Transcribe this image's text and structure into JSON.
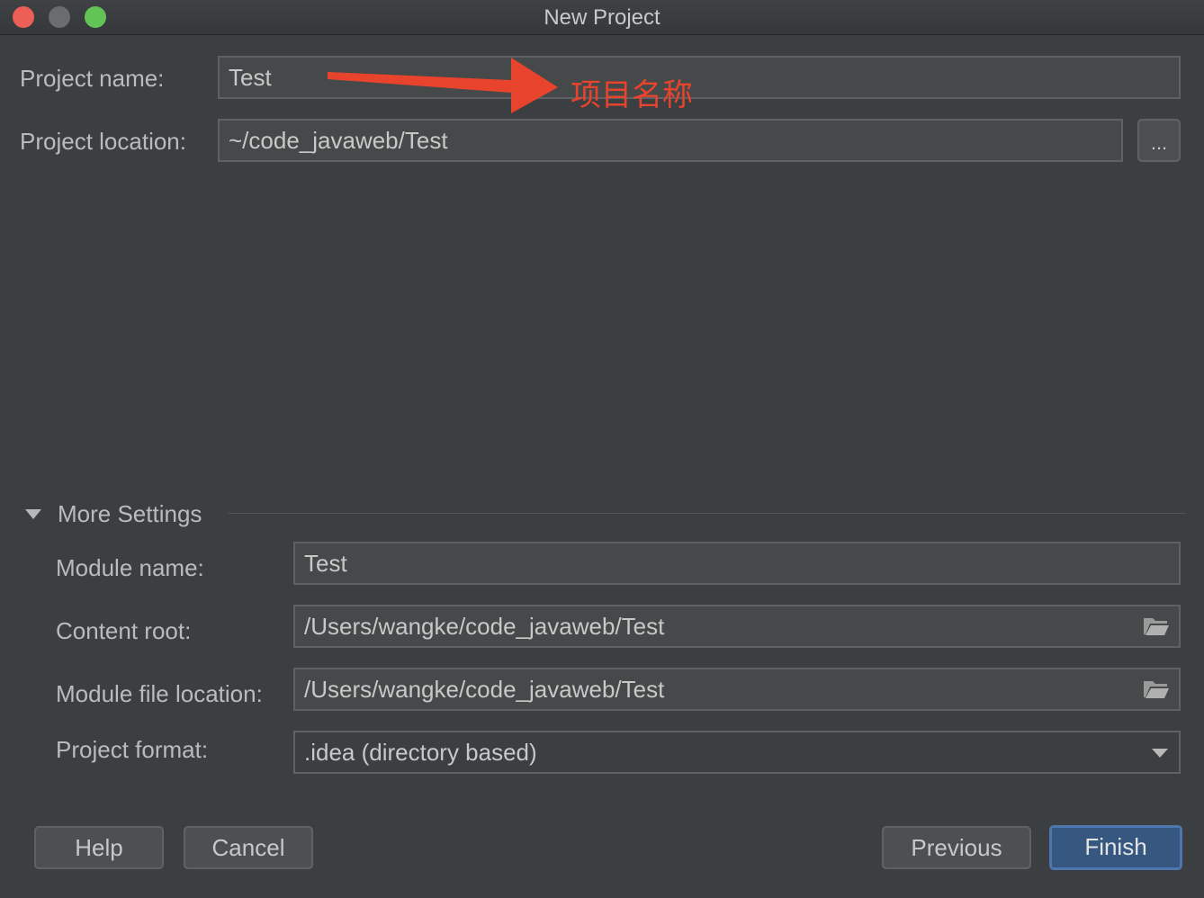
{
  "window": {
    "title": "New Project"
  },
  "form": {
    "project_name_label": "Project name:",
    "project_name_value": "Test",
    "project_location_label": "Project location:",
    "project_location_value": "~/code_javaweb/Test",
    "browse_label": "..."
  },
  "annotation": {
    "text": "项目名称",
    "color": "#e8432c"
  },
  "more_settings": {
    "header": "More Settings",
    "module_name_label": "Module name:",
    "module_name_value": "Test",
    "content_root_label": "Content root:",
    "content_root_value": "/Users/wangke/code_javaweb/Test",
    "module_file_location_label": "Module file location:",
    "module_file_location_value": "/Users/wangke/code_javaweb/Test",
    "project_format_label": "Project format:",
    "project_format_value": ".idea (directory based)"
  },
  "buttons": {
    "help": "Help",
    "cancel": "Cancel",
    "previous": "Previous",
    "finish": "Finish"
  },
  "colors": {
    "background": "#3c3f41",
    "field_background": "#45494a",
    "primary_button": "#365880",
    "close": "#ec5f57",
    "maximize": "#62c454"
  }
}
